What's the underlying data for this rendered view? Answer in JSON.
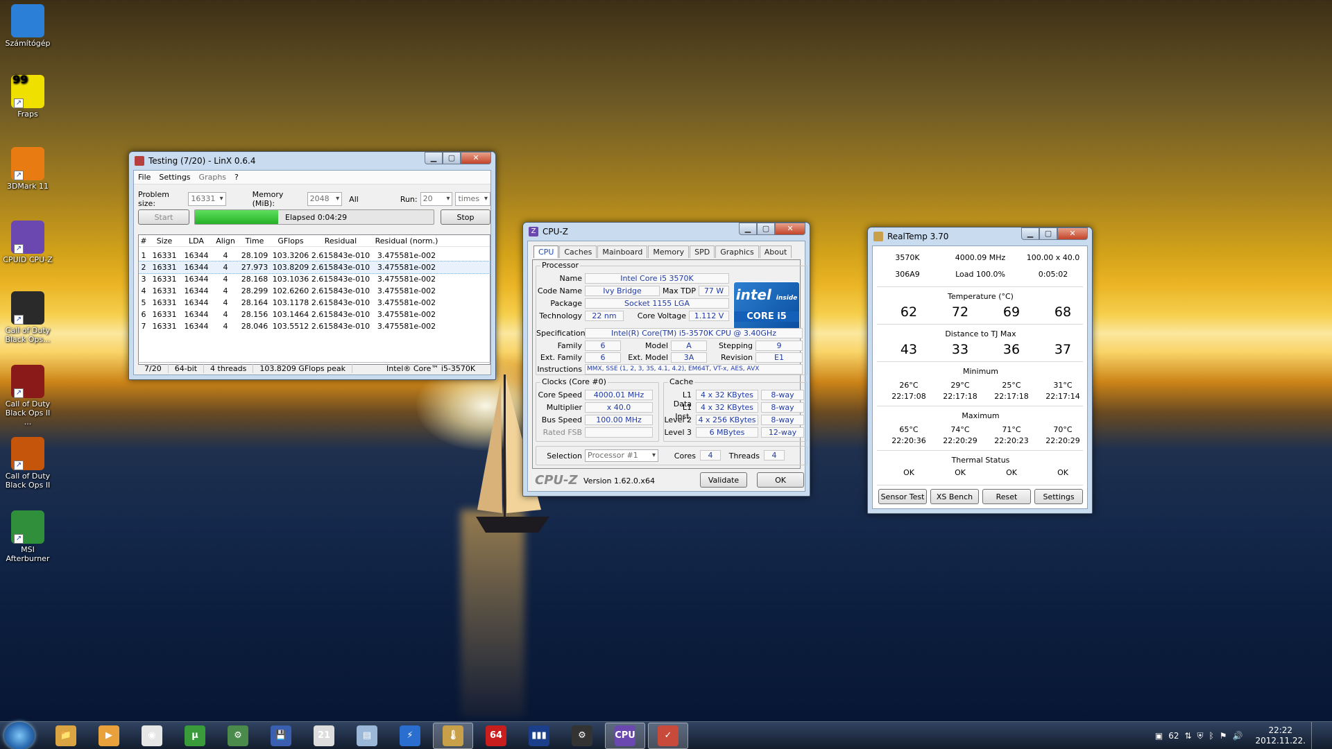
{
  "desktop": {
    "icons": [
      {
        "label": "Számítógép",
        "icon": "computer-icon"
      },
      {
        "label": "Fraps",
        "icon": "fraps-icon"
      },
      {
        "label": "3DMark 11",
        "icon": "3dmark-icon"
      },
      {
        "label": "CPUID CPU-Z",
        "icon": "cpuz-icon"
      },
      {
        "label": "Call of Duty Black Ops...",
        "icon": "cod-icon"
      },
      {
        "label": "Call of Duty Black Ops II ...",
        "icon": "cod-icon"
      },
      {
        "label": "Call of Duty Black Ops II",
        "icon": "cod-icon"
      },
      {
        "label": "MSI Afterburner",
        "icon": "afterburner-icon"
      }
    ],
    "fraps_counter": "99"
  },
  "linx": {
    "title": "Testing (7/20) - LinX 0.6.4",
    "menu": [
      "File",
      "Settings",
      "Graphs",
      "?"
    ],
    "problem_size_label": "Problem size:",
    "problem_size": "16331",
    "memory_label": "Memory (MiB):",
    "memory": "2048",
    "all_label": "All",
    "run_label": "Run:",
    "run": "20",
    "times": "times",
    "start": "Start",
    "stop": "Stop",
    "elapsed": "Elapsed 0:04:29",
    "progress_fraction": 0.35,
    "columns": [
      "#",
      "Size",
      "LDA",
      "Align",
      "Time",
      "GFlops",
      "Residual",
      "Residual (norm.)"
    ],
    "rows": [
      [
        "1",
        "16331",
        "16344",
        "4",
        "28.109",
        "103.3206",
        "2.615843e-010",
        "3.475581e-002"
      ],
      [
        "2",
        "16331",
        "16344",
        "4",
        "27.973",
        "103.8209",
        "2.615843e-010",
        "3.475581e-002"
      ],
      [
        "3",
        "16331",
        "16344",
        "4",
        "28.168",
        "103.1036",
        "2.615843e-010",
        "3.475581e-002"
      ],
      [
        "4",
        "16331",
        "16344",
        "4",
        "28.299",
        "102.6260",
        "2.615843e-010",
        "3.475581e-002"
      ],
      [
        "5",
        "16331",
        "16344",
        "4",
        "28.164",
        "103.1178",
        "2.615843e-010",
        "3.475581e-002"
      ],
      [
        "6",
        "16331",
        "16344",
        "4",
        "28.156",
        "103.1464",
        "2.615843e-010",
        "3.475581e-002"
      ],
      [
        "7",
        "16331",
        "16344",
        "4",
        "28.046",
        "103.5512",
        "2.615843e-010",
        "3.475581e-002"
      ]
    ],
    "status": [
      "7/20",
      "64-bit",
      "4 threads",
      "103.8209 GFlops peak",
      "Intel® Core™ i5-3570K"
    ]
  },
  "cpuz": {
    "title": "CPU-Z",
    "tabs": [
      "CPU",
      "Caches",
      "Mainboard",
      "Memory",
      "SPD",
      "Graphics",
      "About"
    ],
    "processor_group": "Processor",
    "name_l": "Name",
    "name": "Intel Core i5 3570K",
    "codename_l": "Code Name",
    "codename": "Ivy Bridge",
    "maxtdp_l": "Max TDP",
    "maxtdp": "77 W",
    "package_l": "Package",
    "package": "Socket 1155 LGA",
    "tech_l": "Technology",
    "tech": "22 nm",
    "voltage_l": "Core Voltage",
    "voltage": "1.112 V",
    "spec_l": "Specification",
    "spec": "Intel(R) Core(TM) i5-3570K CPU @ 3.40GHz",
    "family_l": "Family",
    "family": "6",
    "model_l": "Model",
    "model": "A",
    "stepping_l": "Stepping",
    "stepping": "9",
    "extfamily_l": "Ext. Family",
    "extfamily": "6",
    "extmodel_l": "Ext. Model",
    "extmodel": "3A",
    "revision_l": "Revision",
    "revision": "E1",
    "instr_l": "Instructions",
    "instr": "MMX, SSE (1, 2, 3, 3S, 4.1, 4.2), EM64T, VT-x, AES, AVX",
    "logo_text_1": "intel",
    "logo_text_2": "inside",
    "logo_text_3": "CORE i5",
    "clocks_group": "Clocks (Core #0)",
    "corespeed_l": "Core Speed",
    "corespeed": "4000.01 MHz",
    "mult_l": "Multiplier",
    "mult": "x 40.0",
    "bus_l": "Bus Speed",
    "bus": "100.00 MHz",
    "fsb_l": "Rated FSB",
    "fsb": "",
    "cache_group": "Cache",
    "l1d_l": "L1 Data",
    "l1d": "4 x 32 KBytes",
    "l1d_w": "8-way",
    "l1i_l": "L1 Inst.",
    "l1i": "4 x 32 KBytes",
    "l1i_w": "8-way",
    "l2_l": "Level 2",
    "l2": "4 x 256 KBytes",
    "l2_w": "8-way",
    "l3_l": "Level 3",
    "l3": "6 MBytes",
    "l3_w": "12-way",
    "selection_l": "Selection",
    "selection": "Processor #1",
    "cores_l": "Cores",
    "cores": "4",
    "threads_l": "Threads",
    "threads": "4",
    "brand": "CPU-Z",
    "version": "Version 1.62.0.x64",
    "validate": "Validate",
    "ok": "OK"
  },
  "realtemp": {
    "title": "RealTemp 3.70",
    "cpu": "3570K",
    "mhz": "4000.09 MHz",
    "mult": "100.00 x 40.0",
    "cpuid": "306A9",
    "load": "Load 100.0%",
    "time": "0:05:02",
    "temp_label": "Temperature (°C)",
    "temps": [
      "62",
      "72",
      "69",
      "68"
    ],
    "dist_label": "Distance to TJ Max",
    "dist": [
      "43",
      "33",
      "36",
      "37"
    ],
    "min_label": "Minimum",
    "min_temps": [
      "26°C",
      "29°C",
      "25°C",
      "31°C"
    ],
    "min_times": [
      "22:17:08",
      "22:17:18",
      "22:17:18",
      "22:17:14"
    ],
    "max_label": "Maximum",
    "max_temps": [
      "65°C",
      "74°C",
      "71°C",
      "70°C"
    ],
    "max_times": [
      "22:20:36",
      "22:20:29",
      "22:20:23",
      "22:20:29"
    ],
    "thermal_label": "Thermal Status",
    "thermal": [
      "OK",
      "OK",
      "OK",
      "OK"
    ],
    "buttons": [
      "Sensor Test",
      "XS Bench",
      "Reset",
      "Settings"
    ]
  },
  "taskbar": {
    "items": [
      {
        "name": "explorer-icon",
        "glyph": "📁"
      },
      {
        "name": "media-player-icon",
        "glyph": "▶"
      },
      {
        "name": "chrome-icon",
        "glyph": "◉"
      },
      {
        "name": "utorrent-icon",
        "glyph": "µ"
      },
      {
        "name": "tool-icon",
        "glyph": "⚙"
      },
      {
        "name": "save-icon",
        "glyph": "💾"
      },
      {
        "name": "calendar-icon",
        "glyph": "21"
      },
      {
        "name": "notepad-icon",
        "glyph": "▤"
      },
      {
        "name": "lightning-icon",
        "glyph": "⚡"
      },
      {
        "name": "realtemp-icon",
        "glyph": "🌡"
      },
      {
        "name": "aida64-icon",
        "glyph": "64"
      },
      {
        "name": "equalizer-icon",
        "glyph": "▮▮▮"
      },
      {
        "name": "steam-icon",
        "glyph": "⚙"
      },
      {
        "name": "cpuz-task-icon",
        "glyph": "CPU"
      },
      {
        "name": "linx-task-icon",
        "glyph": "✓"
      }
    ],
    "tray_temp": "62",
    "time": "22:22",
    "date": "2012.11.22."
  }
}
